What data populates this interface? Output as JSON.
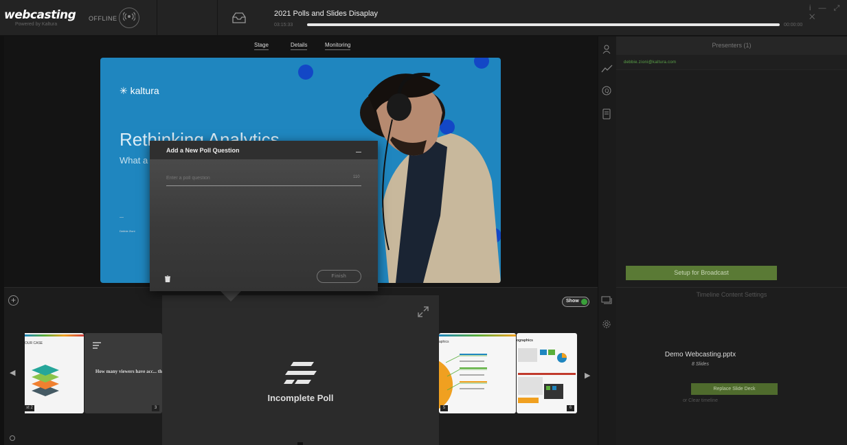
{
  "app": {
    "logo": "webcasting",
    "logo_sub": "Powered by Kaltura",
    "status": "OFFLINE"
  },
  "event": {
    "title": "2021 Polls and Slides Disaplay",
    "elapsed": "03:15:33",
    "total": "00:00:00",
    "progress": 1.0
  },
  "window_controls": "i — ⤢ ✕",
  "stage_tabs": [
    {
      "label": "Stage"
    },
    {
      "label": "Details"
    },
    {
      "label": "Monitoring"
    }
  ],
  "slide": {
    "logo_text": "kaltura",
    "title": "Rethinking Analytics",
    "subtitle": "What a",
    "footer_a": "—",
    "footer_b": "Debbie Zioni"
  },
  "presenters": {
    "header": "Presenters (1)",
    "items": [
      {
        "email": "debbie.zioni@kaltura.com"
      }
    ]
  },
  "setup_button": "Setup for Broadcast",
  "timeline": {
    "header": "Timeline Content Settings",
    "deck_name": "Demo Webcasting.pptx",
    "deck_count": "8 Slides",
    "replace_button": "Replace Slide Deck",
    "clear_link": "or Clear timeline"
  },
  "bottom": {
    "show_label": "Show",
    "thumbs": [
      {
        "title": "OUR CASE",
        "num": "xt 2"
      },
      {
        "title": "How many viewers have acc... throug...",
        "num": "3"
      },
      {
        "title": "aphics",
        "num": "5"
      },
      {
        "title": "ographics",
        "num": "6"
      }
    ],
    "poll": {
      "label": "Incomplete Poll"
    }
  },
  "dialog": {
    "title": "Add a New Poll Question",
    "input_value": "",
    "input_placeholder": "Enter a poll question",
    "char_count": "110",
    "finish_button": "Finish"
  },
  "colors": {
    "accent_green": "#5a7a35",
    "email_green": "#5da84a",
    "slide_blue": "#1f86bf",
    "dot_blue": "#1347c6"
  }
}
